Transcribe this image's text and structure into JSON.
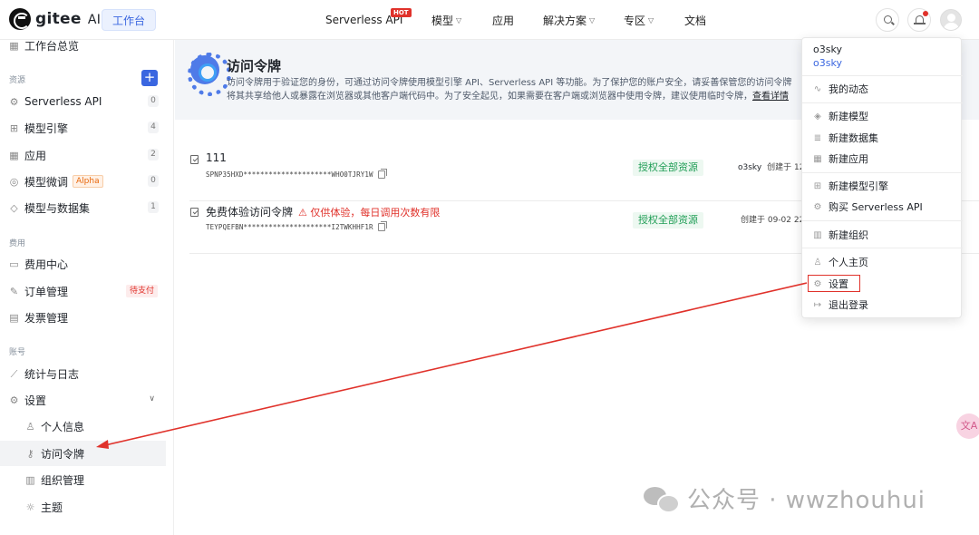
{
  "topbar": {
    "logo_text": "gitee",
    "logo_ai": "AI",
    "workbench": "工作台",
    "nav": [
      {
        "label": "Serverless API",
        "badge": "HOT",
        "dropdown": false
      },
      {
        "label": "模型",
        "dropdown": true
      },
      {
        "label": "应用",
        "dropdown": false
      },
      {
        "label": "解决方案",
        "dropdown": true
      },
      {
        "label": "专区",
        "dropdown": true
      },
      {
        "label": "文档",
        "dropdown": false
      }
    ]
  },
  "sidebar": {
    "overview": "工作台总览",
    "section_resources": "资源",
    "resources": [
      {
        "label": "Serverless API",
        "count": "0",
        "icon": "api-icon"
      },
      {
        "label": "模型引擎",
        "count": "4",
        "icon": "engine-icon"
      },
      {
        "label": "应用",
        "count": "2",
        "icon": "apps-icon"
      },
      {
        "label": "模型微调",
        "badge": "Alpha",
        "count": "0",
        "icon": "finetune-icon"
      },
      {
        "label": "模型与数据集",
        "count": "1",
        "icon": "dataset-icon"
      }
    ],
    "section_billing": "费用",
    "billing": [
      {
        "label": "费用中心",
        "icon": "wallet-icon"
      },
      {
        "label": "订单管理",
        "badge": "待支付",
        "icon": "order-icon"
      },
      {
        "label": "发票管理",
        "icon": "invoice-icon"
      }
    ],
    "section_account": "账号",
    "account": [
      {
        "label": "统计与日志",
        "icon": "chart-icon"
      },
      {
        "label": "设置",
        "icon": "settings-icon"
      }
    ],
    "settings_sub": [
      {
        "label": "个人信息",
        "icon": "user-icon"
      },
      {
        "label": "访问令牌",
        "icon": "key-icon"
      },
      {
        "label": "组织管理",
        "icon": "org-icon"
      },
      {
        "label": "主题",
        "icon": "theme-icon"
      }
    ]
  },
  "hero": {
    "title": "访问令牌",
    "desc_line1": "访问令牌用于验证您的身份，可通过访问令牌使用模型引擎 API、Serverless API 等功能。为了保护您的账户安全，请妥善保管您的访问令牌",
    "desc_line2": "将其共享给他人或暴露在浏览器或其他客户端代码中。为了安全起见，如果需要在客户端或浏览器中使用令牌，建议使用临时令牌，",
    "link": "查看详情"
  },
  "tokens": [
    {
      "name": "111",
      "warning": "",
      "key": "SPNP35HXD*********************WHO0TJRY1W",
      "scope": "授权全部资源",
      "user": "o3sky",
      "created": "创建于 12-"
    },
    {
      "name": "免费体验访问令牌",
      "warning": "⚠ 仅供体验，每日调用次数有限",
      "key": "TEYPQEFBN*********************I2TWKHHF1R",
      "scope": "授权全部资源",
      "user": "",
      "created": "创建于 09-02 22"
    }
  ],
  "dropdown": {
    "name": "o3sky",
    "sub": "o3sky",
    "items": [
      {
        "label": "我的动态",
        "icon": "activity-icon"
      },
      {
        "label": "新建模型",
        "icon": "cube-icon"
      },
      {
        "label": "新建数据集",
        "icon": "database-icon"
      },
      {
        "label": "新建应用",
        "icon": "grid-icon"
      },
      {
        "label": "新建模型引擎",
        "icon": "engine-icon"
      },
      {
        "label": "购买 Serverless API",
        "icon": "cart-icon"
      },
      {
        "label": "新建组织",
        "icon": "org-icon"
      },
      {
        "label": "个人主页",
        "icon": "user-icon"
      },
      {
        "label": "设置",
        "icon": "settings-icon"
      },
      {
        "label": "退出登录",
        "icon": "logout-icon"
      }
    ]
  },
  "float_button": "文A",
  "watermark": "公众号 · wwzhouhui",
  "colors": {
    "accent": "#3a66e0",
    "annotation": "#e0322b",
    "success": "#1f9d55"
  }
}
